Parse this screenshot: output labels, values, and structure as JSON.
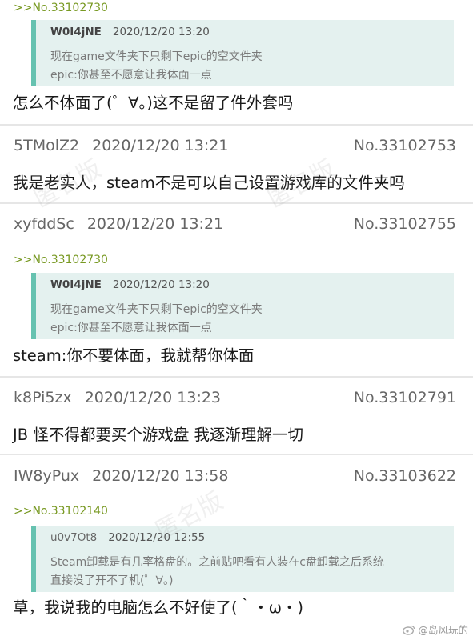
{
  "posts": [
    {
      "reply_ref": ">>No.33102730",
      "quote": {
        "user": "W0I4jNE",
        "time": "2020/12/20 13:20",
        "lines": [
          "现在game文件夹下只剩下epic的空文件夹",
          "epic:你甚至不愿意让我体面一点"
        ]
      },
      "body": "怎么不体面了(゜∀。)这不是留了件外套吗"
    },
    {
      "user": "5TMolZ2",
      "time": "2020/12/20 13:21",
      "no": "No.33102753",
      "body": "我是老实人，steam不是可以自己设置游戏库的文件夹吗"
    },
    {
      "user": "xyfddSc",
      "time": "2020/12/20 13:21",
      "no": "No.33102755",
      "reply_ref": ">>No.33102730",
      "quote": {
        "user": "W0I4jNE",
        "time": "2020/12/20 13:20",
        "lines": [
          "现在game文件夹下只剩下epic的空文件夹",
          "epic:你甚至不愿意让我体面一点"
        ]
      },
      "body": "steam:你不要体面，我就帮你体面"
    },
    {
      "user": "k8Pi5zx",
      "time": "2020/12/20 13:23",
      "no": "No.33102791",
      "body": "JB 怪不得都要买个游戏盘 我逐渐理解一切"
    },
    {
      "user": "IW8yPux",
      "time": "2020/12/20 13:58",
      "no": "No.33103622",
      "reply_ref": ">>No.33102140",
      "quote": {
        "user": "u0v7Ot8",
        "time": "2020/12/20 12:55",
        "lines": [
          "Steam卸载是有几率格盘的。之前贴吧看有人装在c盘卸载之后系统",
          "直接没了开不了机(゜∀。)"
        ]
      },
      "body": "草，我说我的电脑怎么不好使了(｀・ω・)"
    }
  ],
  "watermarks": [
    "匿名版",
    "匿名版",
    "匿名版"
  ],
  "credit": "@岛风玩的"
}
